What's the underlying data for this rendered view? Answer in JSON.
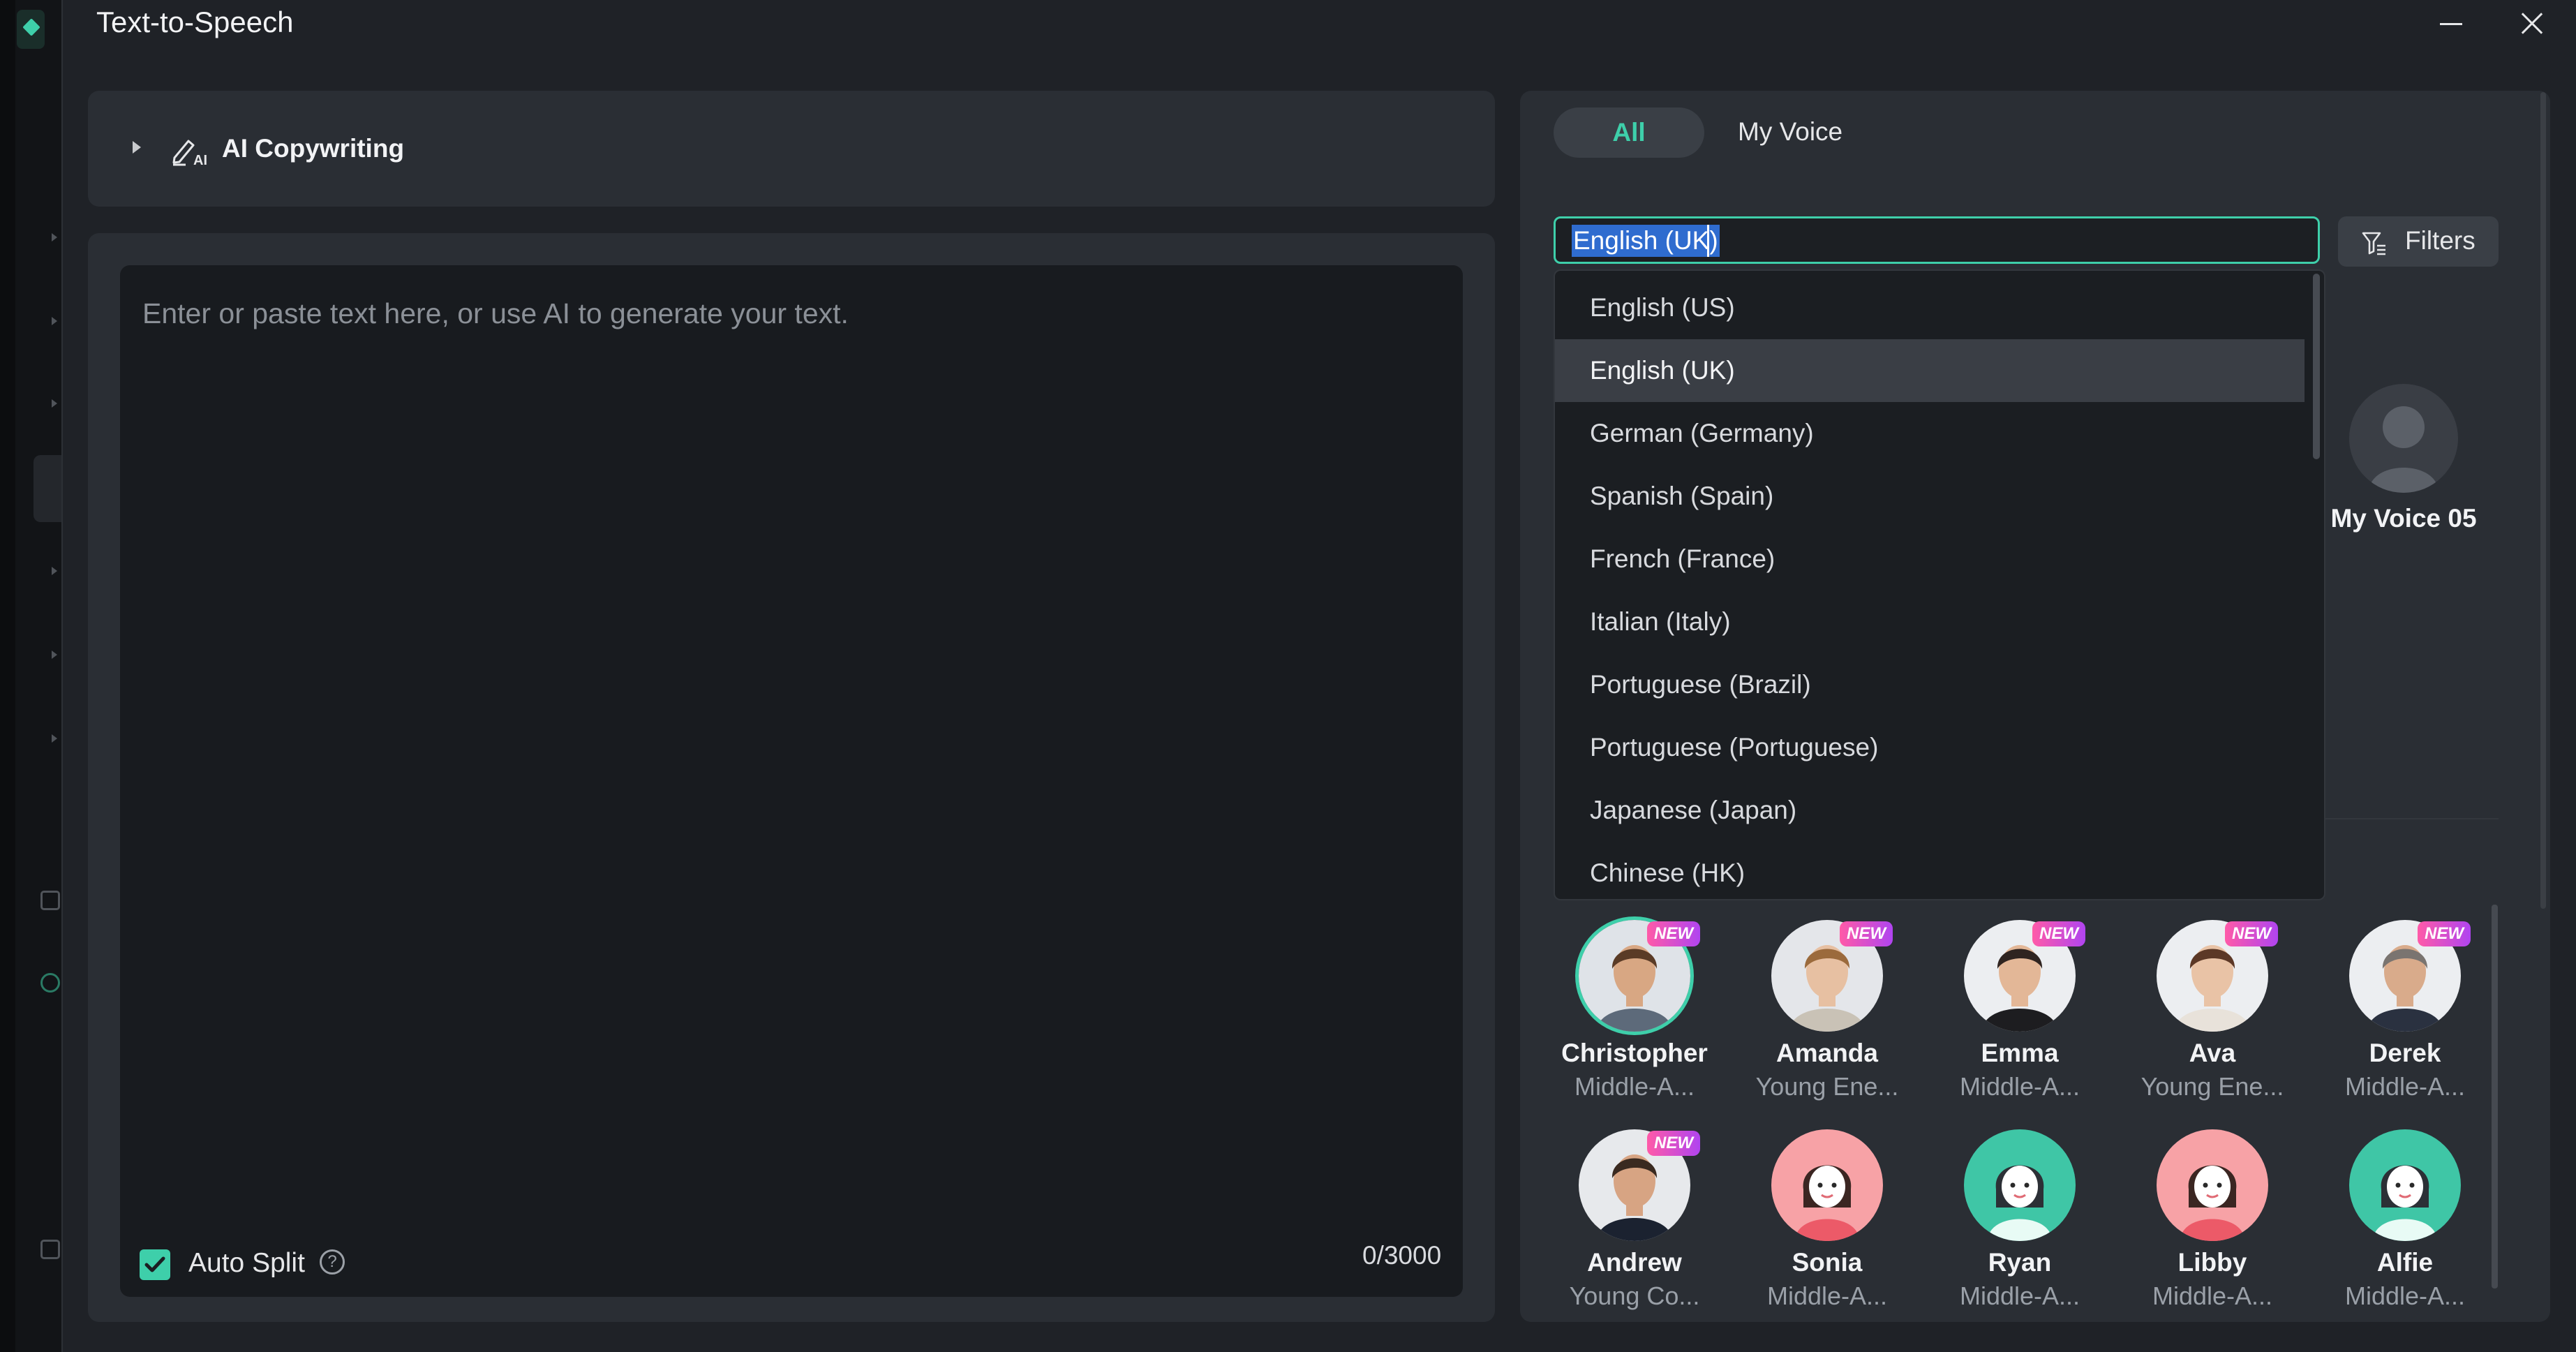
{
  "window": {
    "title": "Text-to-Speech"
  },
  "copywriting": {
    "label": "AI Copywriting"
  },
  "editor": {
    "placeholder": "Enter or paste text here, or use AI to generate your text.",
    "auto_split_label": "Auto Split",
    "auto_split_checked": true,
    "char_count": "0/3000"
  },
  "tabs": [
    {
      "label": "All",
      "active": true
    },
    {
      "label": "My Voice",
      "active": false
    }
  ],
  "language": {
    "input_value": "English (UK)",
    "options": [
      {
        "label": "English (US)",
        "selected": false
      },
      {
        "label": "English (UK)",
        "selected": true
      },
      {
        "label": "German (Germany)",
        "selected": false
      },
      {
        "label": "Spanish (Spain)",
        "selected": false
      },
      {
        "label": "French (France)",
        "selected": false
      },
      {
        "label": "Italian (Italy)",
        "selected": false
      },
      {
        "label": "Portuguese (Brazil)",
        "selected": false
      },
      {
        "label": "Portuguese (Portuguese)",
        "selected": false
      },
      {
        "label": "Japanese (Japan)",
        "selected": false
      },
      {
        "label": "Chinese (HK)",
        "selected": false
      }
    ]
  },
  "filters": {
    "label": "Filters"
  },
  "my_voice": {
    "name": "My Voice 05"
  },
  "voices": [
    {
      "name": "Christopher",
      "desc": "Middle-A...",
      "new": true,
      "selected": true
    },
    {
      "name": "Amanda",
      "desc": "Young Ene...",
      "new": true,
      "selected": false
    },
    {
      "name": "Emma",
      "desc": "Middle-A...",
      "new": true,
      "selected": false
    },
    {
      "name": "Ava",
      "desc": "Young Ene...",
      "new": true,
      "selected": false
    },
    {
      "name": "Derek",
      "desc": "Middle-A...",
      "new": true,
      "selected": false
    },
    {
      "name": "Andrew",
      "desc": "Young Co...",
      "new": true,
      "selected": false
    },
    {
      "name": "Sonia",
      "desc": "Middle-A...",
      "new": false,
      "selected": false
    },
    {
      "name": "Ryan",
      "desc": "Middle-A...",
      "new": false,
      "selected": false
    },
    {
      "name": "Libby",
      "desc": "Middle-A...",
      "new": false,
      "selected": false
    },
    {
      "name": "Alfie",
      "desc": "Middle-A...",
      "new": false,
      "selected": false
    }
  ],
  "badge_text": "NEW",
  "colors": {
    "accent": "#3ecfaa",
    "panel": "#2a2e34",
    "background": "#1f2227",
    "badge": "#e84fc2"
  }
}
